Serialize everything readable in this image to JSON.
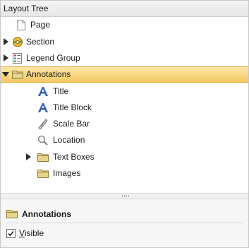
{
  "panel": {
    "title": "Layout Tree"
  },
  "tree": [
    {
      "label": "Page",
      "icon": "page-icon",
      "expander": "none",
      "selected": false
    },
    {
      "label": "Section",
      "icon": "section-icon",
      "expander": "collapsed",
      "selected": false
    },
    {
      "label": "Legend Group",
      "icon": "legend-icon",
      "expander": "collapsed",
      "selected": false
    },
    {
      "label": "Annotations",
      "icon": "folder-icon",
      "expander": "expanded",
      "selected": true
    },
    {
      "label": "Title",
      "icon": "text-a-icon",
      "expander": "none",
      "selected": false
    },
    {
      "label": "Title Block",
      "icon": "text-a-icon",
      "expander": "none",
      "selected": false
    },
    {
      "label": "Scale Bar",
      "icon": "ruler-icon",
      "expander": "none",
      "selected": false
    },
    {
      "label": "Location",
      "icon": "magnifier-icon",
      "expander": "none",
      "selected": false
    },
    {
      "label": "Text Boxes",
      "icon": "folder-icon",
      "expander": "collapsed",
      "selected": false
    },
    {
      "label": "Images",
      "icon": "folder-icon",
      "expander": "none",
      "selected": false
    }
  ],
  "properties": {
    "title": "Annotations",
    "visible_label": "Visible",
    "visible_checked": true
  },
  "colors": {
    "selection": "#f7c964",
    "folder": "#e8d38a"
  }
}
